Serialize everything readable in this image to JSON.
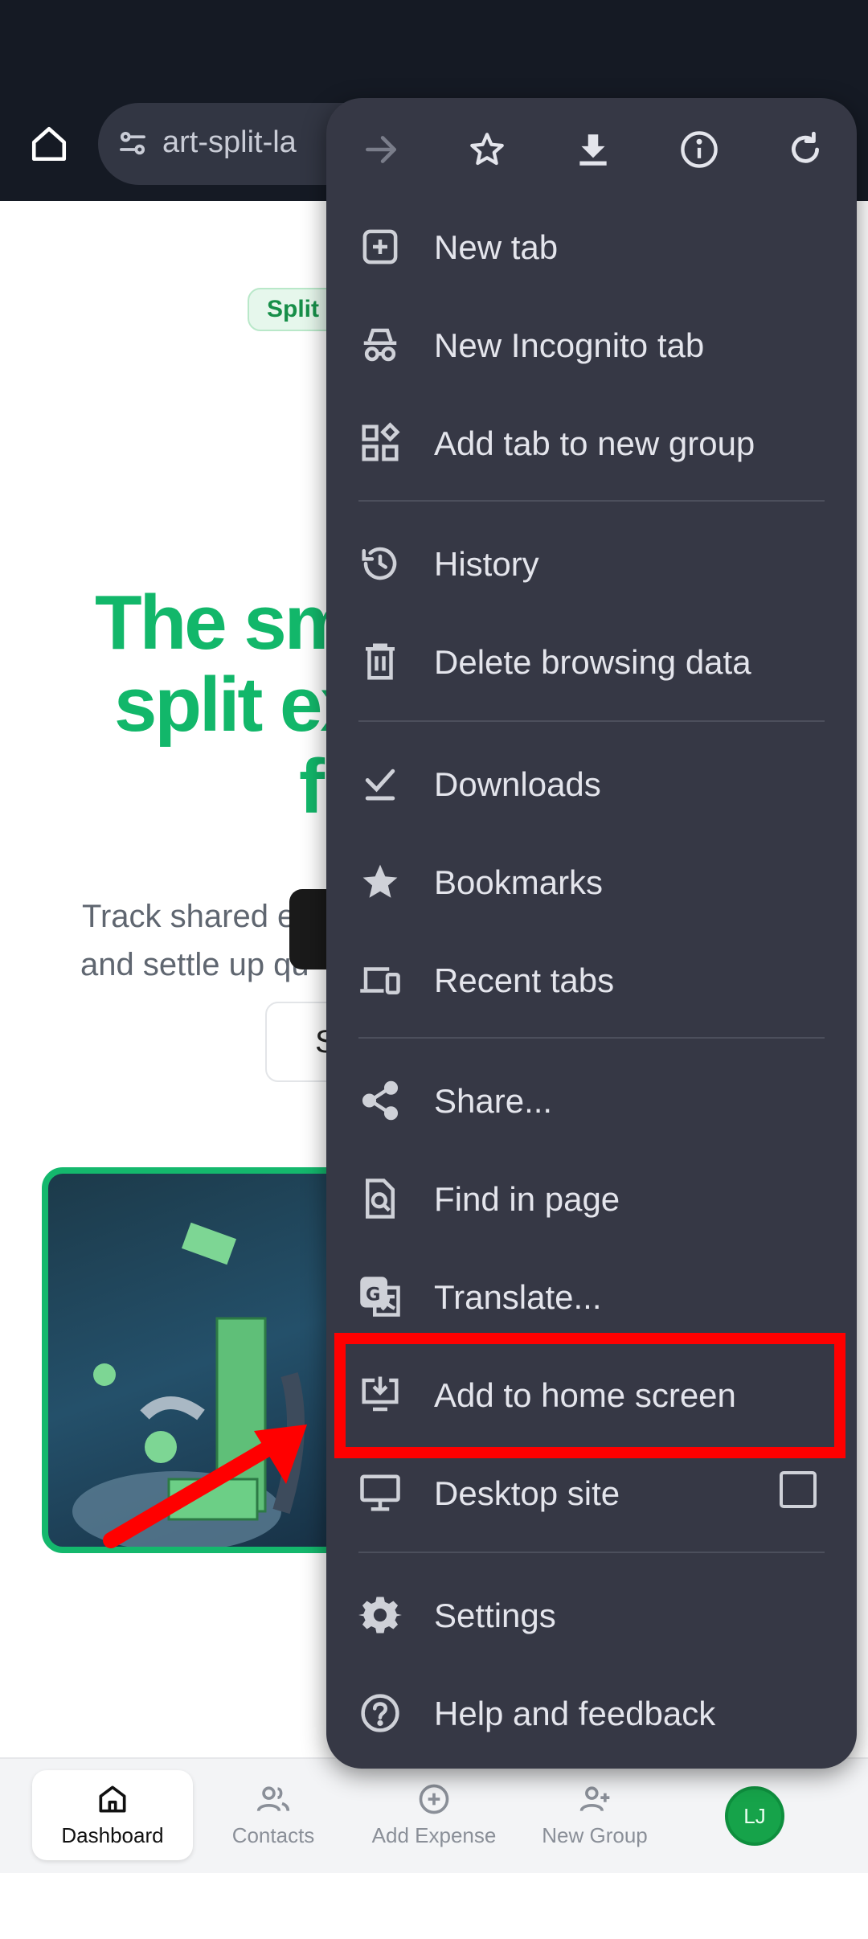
{
  "browser": {
    "url_text": "art-split-la",
    "icons": {
      "home": "home-icon",
      "site_settings": "tune-icon",
      "forward": "forward-arrow-icon",
      "bookmark": "star-outline-icon",
      "download": "download-icon",
      "info": "info-icon",
      "reload": "reload-icon"
    }
  },
  "page": {
    "pill_text": "Split E",
    "hero_lines": [
      "The sm",
      "split ex",
      "f"
    ],
    "sub_lines": [
      "Track shared ex",
      "and settle up qu"
    ],
    "cta_secondary_text": "S"
  },
  "menu": {
    "items": [
      {
        "label": "New tab",
        "icon": "add-box-icon"
      },
      {
        "label": "New Incognito tab",
        "icon": "incognito-icon"
      },
      {
        "label": "Add tab to new group",
        "icon": "tab-group-icon"
      },
      {
        "label": "History",
        "icon": "history-icon"
      },
      {
        "label": "Delete browsing data",
        "icon": "trash-icon"
      },
      {
        "label": "Downloads",
        "icon": "downloads-check-icon"
      },
      {
        "label": "Bookmarks",
        "icon": "star-filled-icon"
      },
      {
        "label": "Recent tabs",
        "icon": "devices-icon"
      },
      {
        "label": "Share...",
        "icon": "share-icon"
      },
      {
        "label": "Find in page",
        "icon": "find-in-page-icon"
      },
      {
        "label": "Translate...",
        "icon": "translate-icon"
      },
      {
        "label": "Add to home screen",
        "icon": "add-to-home-icon"
      },
      {
        "label": "Desktop site",
        "icon": "desktop-icon"
      },
      {
        "label": "Settings",
        "icon": "gear-icon"
      },
      {
        "label": "Help and feedback",
        "icon": "help-icon"
      }
    ],
    "desktop_site_checked": false
  },
  "bottom_nav": {
    "items": [
      {
        "label": "Dashboard",
        "icon": "home-outline-icon",
        "active": true
      },
      {
        "label": "Contacts",
        "icon": "users-icon",
        "active": false
      },
      {
        "label": "Add Expense",
        "icon": "plus-circle-icon",
        "active": false
      },
      {
        "label": "New Group",
        "icon": "user-plus-icon",
        "active": false
      }
    ],
    "avatar_initials": "LJ"
  },
  "annotation": {
    "highlight_color": "#ff0000",
    "highlighted_item": "Add to home screen"
  }
}
